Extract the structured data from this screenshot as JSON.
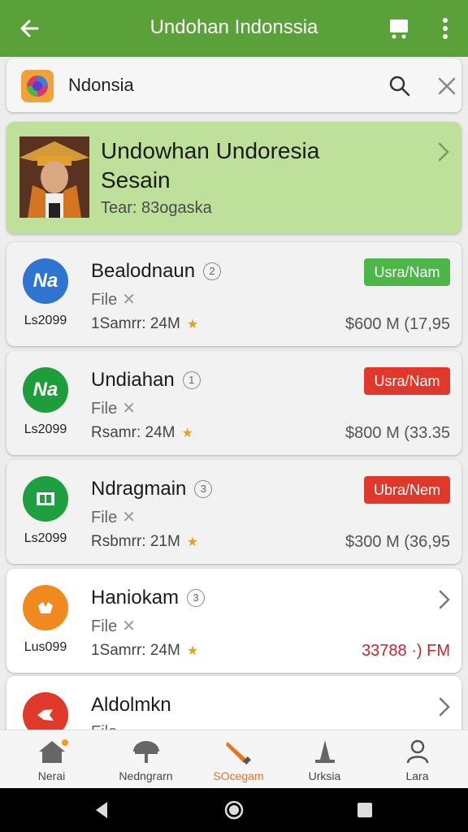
{
  "header": {
    "title": "Undohan Indonssia"
  },
  "search": {
    "query": "Ndonsia"
  },
  "hero": {
    "title_line1": "Undowhan Undoresia",
    "title_line2": "Sesain",
    "subtitle": "Tear: 83ogaska"
  },
  "items": [
    {
      "icon_text": "Na",
      "icon_color": "#2f74d0",
      "code": "Ls2099",
      "name": "Bealodnaun",
      "num": "2",
      "file": "File",
      "meta": "1Samrr: 24M",
      "badge": "Usra/Nam",
      "badge_color": "#4cb648",
      "price": "$600 M (17,95",
      "price_red": false
    },
    {
      "icon_text": "Na",
      "icon_color": "#1e9e3a",
      "code": "Ls2099",
      "name": "Undiahan",
      "num": "1",
      "file": "File",
      "meta": "Rsamr: 24M",
      "badge": "Usra/Nam",
      "badge_color": "#e0392b",
      "price": "$800 M (33.35",
      "price_red": false
    },
    {
      "icon_text": "",
      "icon_color": "#1fa040",
      "code": "Ls2099",
      "name": "Ndragmain",
      "num": "3",
      "file": "File",
      "meta": "Rsbmrr: 21M",
      "badge": "Ubra/Nem",
      "badge_color": "#e0392b",
      "price": "$300 M (36,95",
      "price_red": false
    },
    {
      "icon_text": "",
      "icon_color": "#f08a1e",
      "code": "Lus099",
      "name": "Haniokam",
      "num": "3",
      "file": "File",
      "meta": "1Samrr: 24M",
      "badge": "",
      "badge_color": "",
      "price": "33788 ·) FM",
      "price_red": true
    },
    {
      "icon_text": "",
      "icon_color": "#e0392b",
      "code": "",
      "name": "Aldolmkn",
      "num": "",
      "file": "File",
      "meta": "",
      "badge": "",
      "badge_color": "",
      "price": "",
      "price_red": false
    }
  ],
  "bottom_nav": [
    {
      "label": "Nerai",
      "icon": "home-icon"
    },
    {
      "label": "Nedngrarn",
      "icon": "bookmark-icon"
    },
    {
      "label": "SOcegam",
      "icon": "brush-icon",
      "active": true
    },
    {
      "label": "Urksia",
      "icon": "cone-icon"
    },
    {
      "label": "Lara",
      "icon": "person-icon"
    }
  ],
  "colors": {
    "appbar": "#5aa13a",
    "hero": "#bfe09a",
    "active": "#e8731a"
  }
}
